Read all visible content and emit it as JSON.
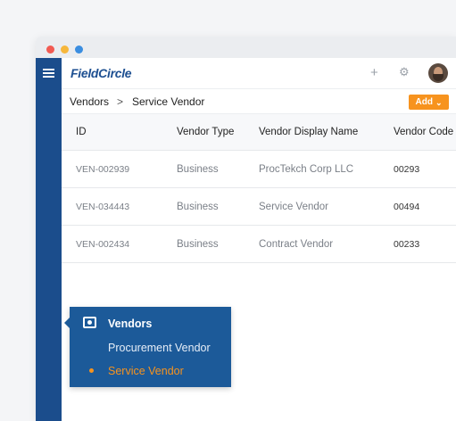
{
  "app": {
    "logo": "FieldCircle",
    "plus_icon": "+",
    "gear_icon": "⚙"
  },
  "breadcrumb": {
    "first": "Vendors",
    "separator": ">",
    "second": "Service Vendor"
  },
  "toolbar": {
    "add_label": "Add",
    "add_chevron": "⌄"
  },
  "table": {
    "headers": [
      "ID",
      "Vendor Type",
      "Vendor Display Name",
      "Vendor Code"
    ],
    "rows": [
      [
        "VEN-002939",
        "Business",
        "ProcTekch Corp LLC",
        "00293"
      ],
      [
        "VEN-034443",
        "Business",
        "Service Vendor",
        "00494"
      ],
      [
        "VEN-002434",
        "Business",
        "Contract Vendor",
        "00233"
      ]
    ]
  },
  "popup": {
    "title": "Vendors",
    "items": [
      "Procurement Vendor",
      "Service Vendor"
    ]
  },
  "colors": {
    "brand": "#1d4f91",
    "sidebar": "#1b4d8c",
    "accent": "#f7931e",
    "popup": "#1c5a99"
  }
}
